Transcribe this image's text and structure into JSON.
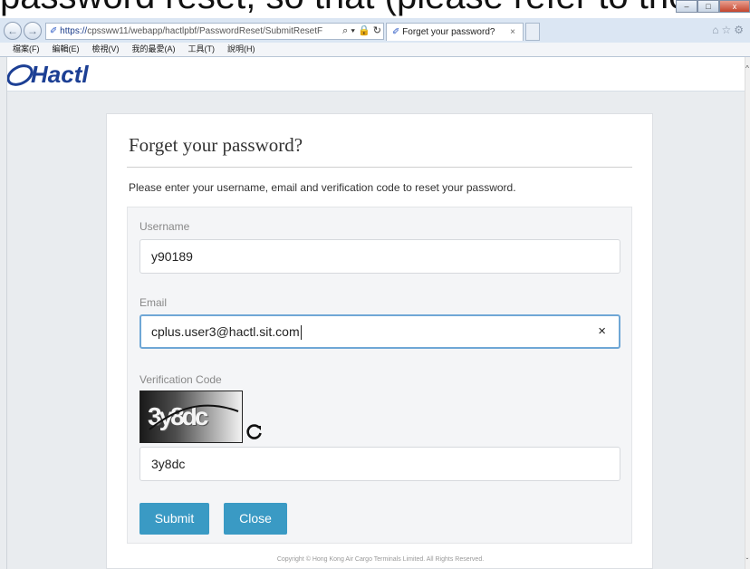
{
  "browser": {
    "top_strip_text": "password reset, so that (please refer to the email sent to you)",
    "address_https": "https://",
    "address_rest": "cpssww11/webapp/hactlpbf/PasswordReset/SubmitResetF",
    "address_icons": "⌕ ▾ 🔒 ↻",
    "tab_title": "Forget your password?",
    "tab_close": "×",
    "menu": [
      "檔案(F)",
      "編輯(E)",
      "檢視(V)",
      "我的最愛(A)",
      "工具(T)",
      "說明(H)"
    ],
    "window_min": "–",
    "window_max": "□",
    "window_close": "x",
    "toolbar_icons": "⌂☆⚙"
  },
  "header": {
    "logo_text": "Hactl"
  },
  "form": {
    "title": "Forget your password?",
    "description": "Please enter your username, email and verification code to reset your password.",
    "username_label": "Username",
    "username_value": "y90189",
    "email_label": "Email",
    "email_value": "cplus.user3@hactl.sit.com",
    "clear_symbol": "×",
    "verification_label": "Verification Code",
    "captcha_text": "3y8dc",
    "verification_value": "3y8dc",
    "submit_label": "Submit",
    "close_label": "Close",
    "copyright": "Copyright © Hong Kong Air Cargo Terminals Limited. All Rights Reserved."
  },
  "colors": {
    "accent_button": "#3a9ac4",
    "focus_border": "#6fa7d6",
    "logo_blue": "#1c3f94"
  }
}
